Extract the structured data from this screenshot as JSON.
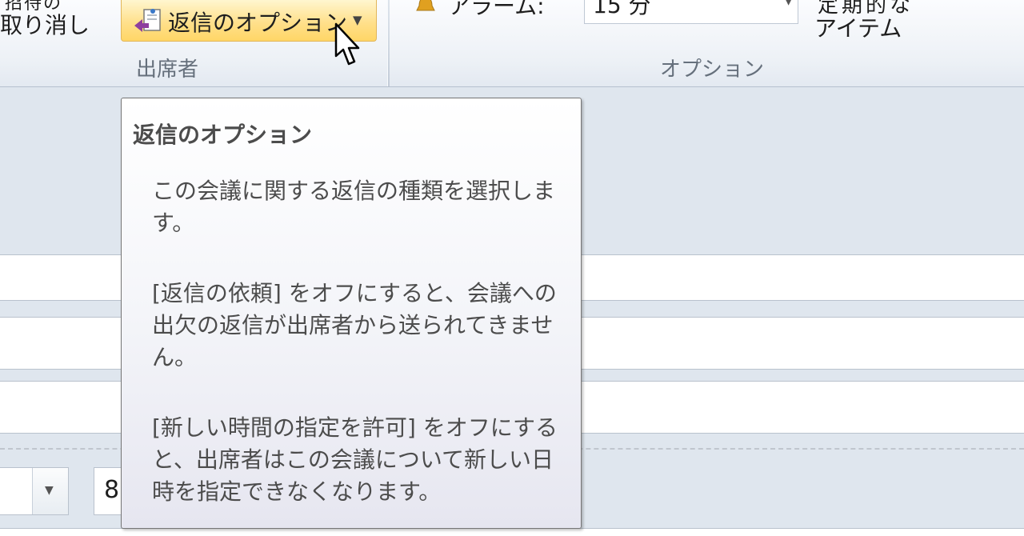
{
  "ribbon": {
    "cancel_invitation": {
      "label": "取り消し",
      "top_label": "招待の"
    },
    "attendees_group": {
      "label": "出席者",
      "response_options_button": {
        "label": "返信のオプション",
        "icon": "response-options-icon"
      }
    },
    "options_group": {
      "label": "オプション",
      "reminder": {
        "label": "アラーム:",
        "value": "15 分",
        "icon": "bell-icon"
      },
      "recurrence_item": {
        "top_label": "定期的な",
        "label": "アイテム"
      }
    }
  },
  "tooltip": {
    "title": "返信のオプション",
    "paragraphs": [
      "この会議に関する返信の種類を選択します。",
      "[返信の依頼] をオフにすると、会議への出欠の返信が出席者から送られてきません。",
      "[新しい時間の指定を許可] をオフにすると、出席者はこの会議について新しい日時を指定できなくなります。"
    ]
  },
  "form": {
    "date_value": "8"
  },
  "colors": {
    "highlight": "#ffd666",
    "tooltip_border": "#767676",
    "ribbon_bg": "#edf1f6"
  }
}
